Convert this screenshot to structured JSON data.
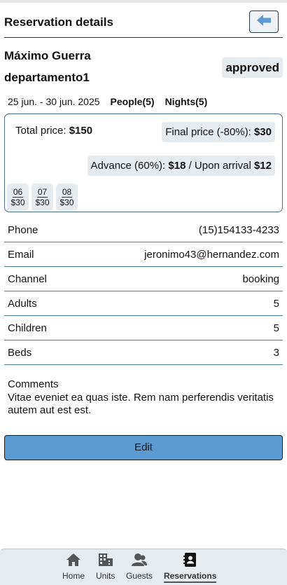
{
  "header": {
    "title": "Reservation details",
    "back_icon": "arrow-left-icon"
  },
  "reservation": {
    "guest_name": "Máximo Guerra",
    "unit_name": "departamento1",
    "status": "approved",
    "dates": "25 jun. - 30 jun. 2025",
    "people": "People(5)",
    "nights": "Nights(5)"
  },
  "pricing": {
    "total_label": "Total price: ",
    "total_value": "$150",
    "final_label": "Final price (-80%): ",
    "final_value": "$30",
    "advance_label": "Advance (60%): ",
    "advance_value": "$18",
    "arrival_label": " / Upon arrival ",
    "arrival_value": "$12",
    "days": [
      {
        "day": "06",
        "price": "$30"
      },
      {
        "day": "07",
        "price": "$30"
      },
      {
        "day": "08",
        "price": "$30"
      }
    ]
  },
  "details": [
    {
      "label": "Phone",
      "value": "(15)154133-4233"
    },
    {
      "label": "Email",
      "value": "jeronimo43@hernandez.com"
    },
    {
      "label": "Channel",
      "value": "booking"
    },
    {
      "label": "Adults",
      "value": "5"
    },
    {
      "label": "Children",
      "value": "5"
    },
    {
      "label": "Beds",
      "value": "3"
    }
  ],
  "comments": {
    "label": "Comments",
    "text": "Vitae eveniet ea quas iste. Rem nam perferendis veritatis autem aut est est."
  },
  "edit_label": "Edit",
  "nav": {
    "items": [
      {
        "label": "Home",
        "icon": "home-icon"
      },
      {
        "label": "Units",
        "icon": "building-icon"
      },
      {
        "label": "Guests",
        "icon": "guests-icon"
      },
      {
        "label": "Reservations",
        "icon": "address-book-icon"
      }
    ],
    "active": "Reservations"
  },
  "colors": {
    "accent": "#5c9bd1",
    "chip_bg": "#e6ebf0",
    "divider": "#4a8196"
  }
}
